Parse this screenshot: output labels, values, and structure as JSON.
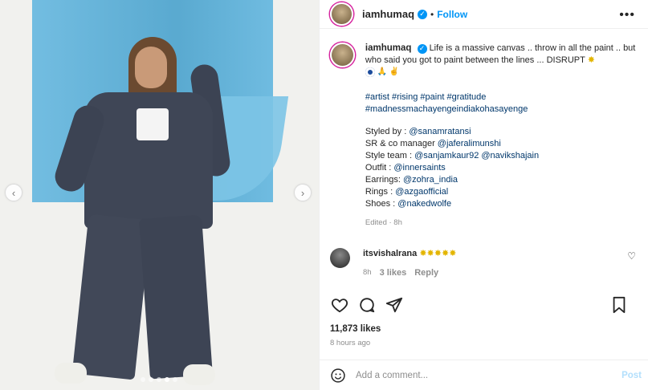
{
  "header": {
    "username": "iamhumaq",
    "separator": "•",
    "follow_label": "Follow",
    "more_icon": "more-icon"
  },
  "media": {
    "prev_label": "‹",
    "next_label": "›",
    "dots_count": 5,
    "active_dot": 4
  },
  "caption": {
    "username": "iamhumaq",
    "text": "Life is a massive canvas .. throw in all the paint .. but who said you got to paint between the lines ... DISRUPT",
    "hashtags": [
      "#artist",
      "#rising",
      "#paint",
      "#gratitude",
      "#madnessmachayengeindiakohasayenge"
    ],
    "credits": [
      {
        "label": "Styled by : ",
        "handles": [
          "@sanamratansi"
        ]
      },
      {
        "label": "SR & co manager ",
        "handles": [
          "@jaferalimunshi"
        ]
      },
      {
        "label": "Style team : ",
        "handles": [
          "@sanjamkaur92",
          "@navikshajain"
        ]
      },
      {
        "label": "Outfit : ",
        "handles": [
          "@innersaints"
        ]
      },
      {
        "label": "Earrings: ",
        "handles": [
          "@zohra_india"
        ]
      },
      {
        "label": "Rings : ",
        "handles": [
          "@azgaofficial"
        ]
      },
      {
        "label": "Shoes : ",
        "handles": [
          "@nakedwolfe"
        ]
      }
    ],
    "meta": "Edited · 8h"
  },
  "reply": {
    "username": "itsvishalrana",
    "time": "8h",
    "likes": "3 likes",
    "reply_label": "Reply"
  },
  "actions": {
    "likes_count": "11,873 likes",
    "time_ago": "8 hours ago"
  },
  "add_comment": {
    "placeholder": "Add a comment...",
    "post_label": "Post"
  }
}
